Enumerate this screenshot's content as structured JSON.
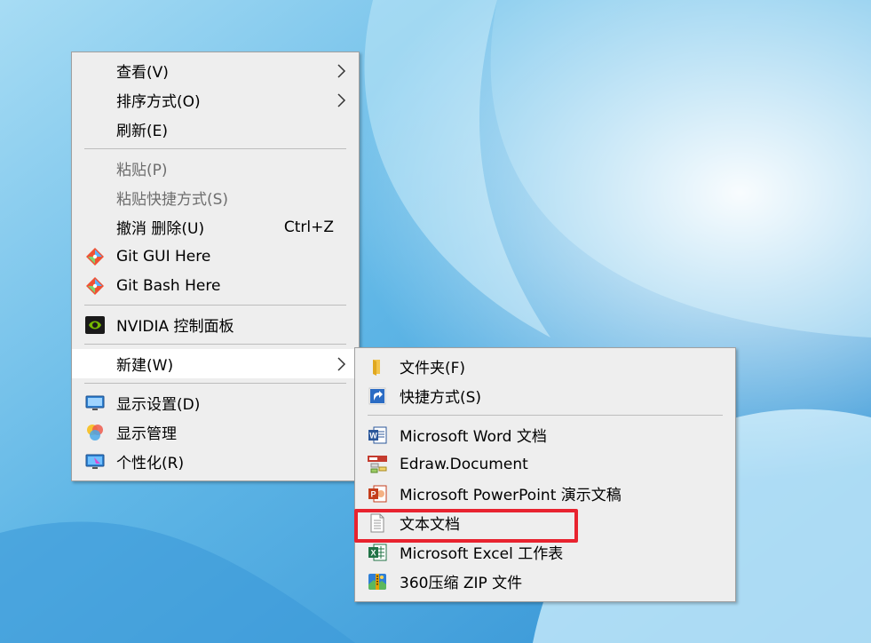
{
  "desktop": {
    "accent": "#7cc4ea"
  },
  "context_menu": {
    "items": [
      {
        "label": "查看(V)",
        "has_submenu": true
      },
      {
        "label": "排序方式(O)",
        "has_submenu": true
      },
      {
        "label": "刷新(E)"
      },
      {
        "label": "粘贴(P)",
        "disabled": true
      },
      {
        "label": "粘贴快捷方式(S)",
        "disabled": true
      },
      {
        "label": "撤消 删除(U)",
        "shortcut": "Ctrl+Z"
      },
      {
        "label": "Git GUI Here",
        "icon": "git-gui-icon"
      },
      {
        "label": "Git Bash Here",
        "icon": "git-bash-icon"
      },
      {
        "label": "NVIDIA 控制面板",
        "icon": "nvidia-icon"
      },
      {
        "label": "新建(W)",
        "has_submenu": true,
        "highlighted": true
      },
      {
        "label": "显示设置(D)",
        "icon": "display-settings-icon"
      },
      {
        "label": "显示管理",
        "icon": "display-manager-icon"
      },
      {
        "label": "个性化(R)",
        "icon": "personalize-icon"
      }
    ]
  },
  "new_submenu": {
    "items": [
      {
        "label": "文件夹(F)",
        "icon": "folder-icon"
      },
      {
        "label": "快捷方式(S)",
        "icon": "shortcut-icon"
      },
      {
        "label": "Microsoft Word 文档",
        "icon": "word-icon"
      },
      {
        "label": "Edraw.Document",
        "icon": "edraw-icon"
      },
      {
        "label": "Microsoft PowerPoint 演示文稿",
        "icon": "powerpoint-icon"
      },
      {
        "label": "文本文档",
        "icon": "text-document-icon",
        "annotated": true
      },
      {
        "label": "Microsoft Excel 工作表",
        "icon": "excel-icon"
      },
      {
        "label": "360压缩 ZIP 文件",
        "icon": "zip-icon"
      }
    ]
  },
  "annotation": {
    "color": "#e8232f"
  }
}
